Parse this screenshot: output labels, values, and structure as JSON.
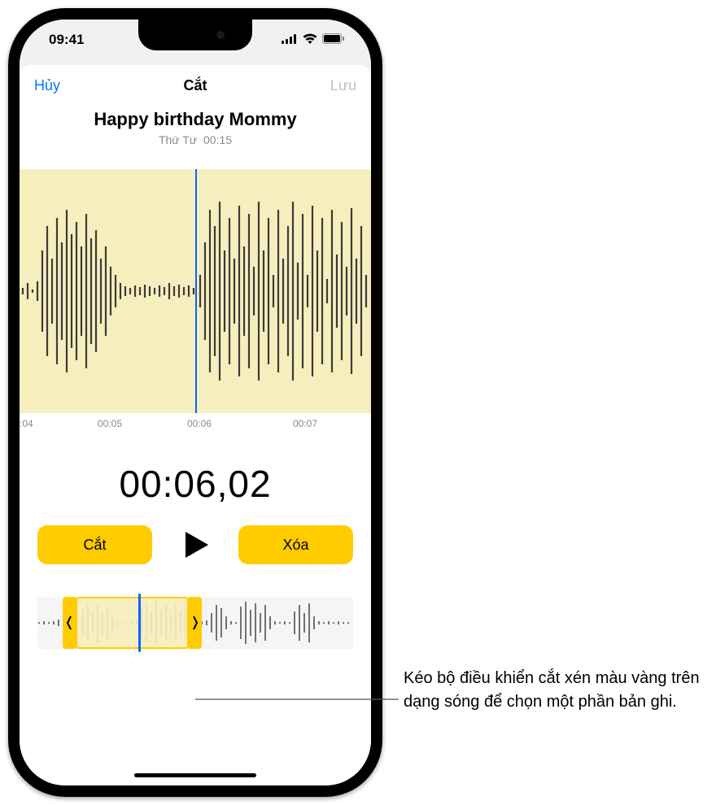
{
  "status": {
    "time": "09:41"
  },
  "nav": {
    "cancel": "Hủy",
    "title": "Cắt",
    "save": "Lưu"
  },
  "recording": {
    "name": "Happy birthday Mommy",
    "meta_day": "Thứ Tư",
    "meta_duration": "00:15"
  },
  "ruler": {
    "t0": ":04",
    "t1": "00:05",
    "t2": "00:06",
    "t3": "00:07"
  },
  "playback": {
    "time": "00:06,02"
  },
  "buttons": {
    "trim": "Cắt",
    "delete": "Xóa"
  },
  "trim_overview": {
    "selection_start_pct": 12,
    "selection_end_pct": 48,
    "playhead_pct": 32
  },
  "callout": {
    "text": "Kéo bộ điều khiển cắt xén màu vàng trên dạng sóng để chọn một phần bản ghi."
  }
}
